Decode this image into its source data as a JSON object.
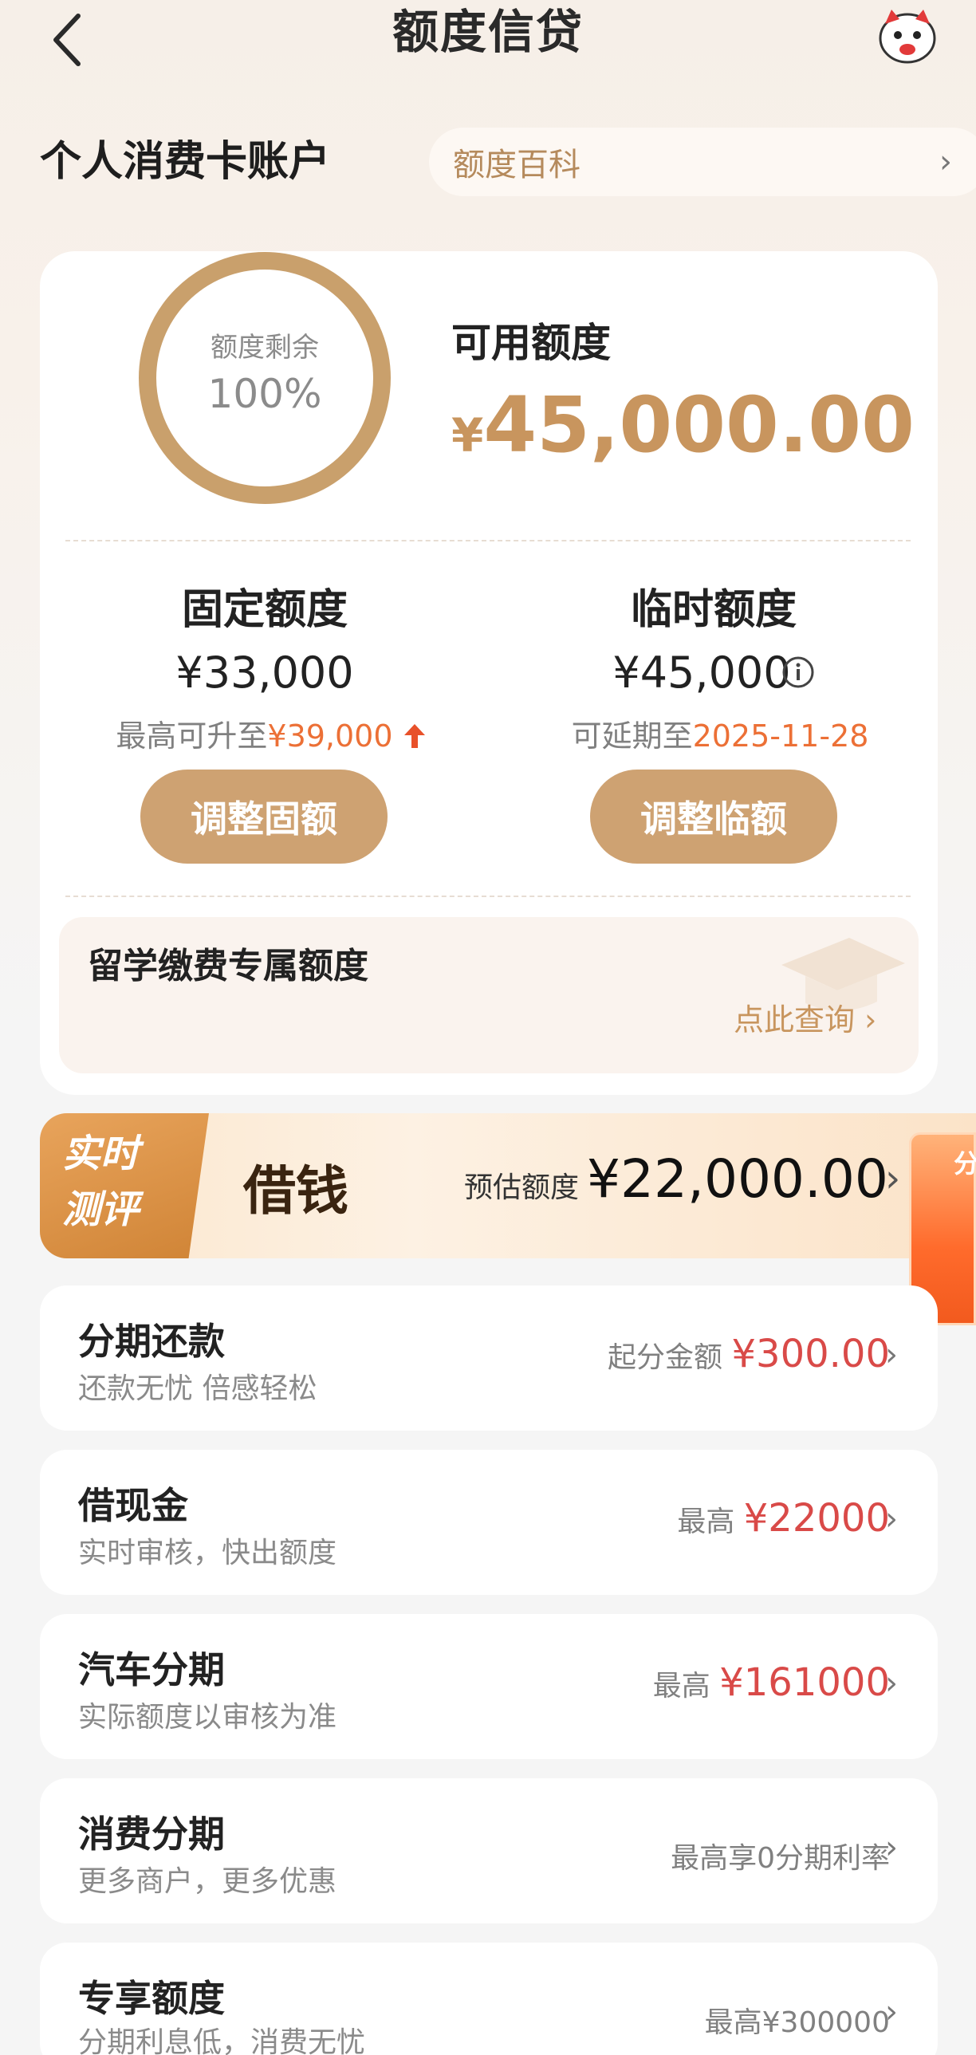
{
  "header": {
    "title": "额度信贷"
  },
  "account": {
    "title": "个人消费卡账户",
    "encyclopedia_label": "额度百科"
  },
  "summary": {
    "ring_label": "额度剩余",
    "ring_value": "100%",
    "available_label": "可用额度",
    "available_currency": "¥",
    "available_amount": "45,000.00"
  },
  "fixed": {
    "title": "固定额度",
    "amount": "¥33,000",
    "sub_prefix": "最高可升至",
    "sub_value": "¥39,000",
    "button": "调整固额"
  },
  "temporary": {
    "title": "临时额度",
    "amount": "¥45,000",
    "sub_prefix": "可延期至",
    "sub_value": "2025-11-28",
    "button": "调整临额"
  },
  "study": {
    "title": "留学缴费专属额度",
    "link": "点此查询 ›"
  },
  "borrow": {
    "badge_line1": "实时",
    "badge_line2": "测评",
    "title": "借钱",
    "estimate_label": "预估额度",
    "estimate_value": "¥22,000.00",
    "float_text": "分"
  },
  "items": [
    {
      "title": "分期还款",
      "sub": "还款无忧 倍感轻松",
      "right_label": "起分金额 ",
      "right_amount": "¥300.00"
    },
    {
      "title": "借现金",
      "sub": "实时审核，快出额度",
      "right_label": "最高 ",
      "right_amount": "¥22000"
    },
    {
      "title": "汽车分期",
      "sub": "实际额度以审核为准",
      "right_label": "最高 ",
      "right_amount": "¥161000"
    },
    {
      "title": "消费分期",
      "sub": "更多商户，更多优惠",
      "right_label": "最高享0分期利率",
      "right_amount": ""
    },
    {
      "title": "专享额度",
      "sub": "分期利息低，消费无忧",
      "right_label": "最高¥300000",
      "right_amount": ""
    }
  ],
  "colors": {
    "gold": "#c9a06c",
    "button_gold": "#cea272",
    "highlight_orange": "#ec7036",
    "amount_red": "#d94a48"
  },
  "icons": {
    "back": "chevron-left-icon",
    "mascot": "mascot-icon",
    "info": "info-icon",
    "arrow_up": "arrow-up-icon",
    "cap": "graduation-cap-icon",
    "chevron": "chevron-right-icon"
  }
}
